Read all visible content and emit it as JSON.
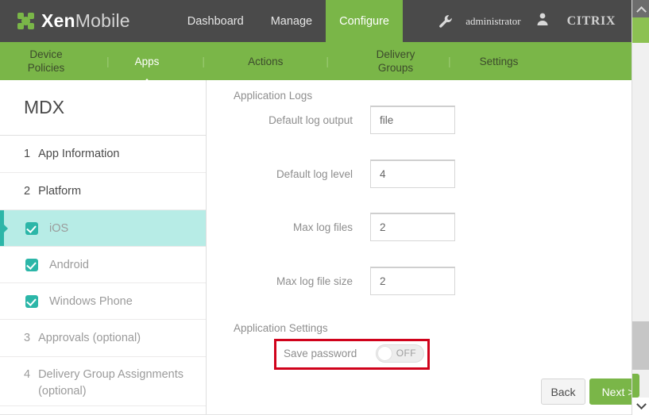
{
  "header": {
    "logo_brand": "Xen",
    "logo_brand2": "Mobile",
    "nav": [
      {
        "label": "Dashboard",
        "active": false
      },
      {
        "label": "Manage",
        "active": false
      },
      {
        "label": "Configure",
        "active": true
      }
    ],
    "wrench_icon": "wrench-icon",
    "username": "administrator",
    "user_icon": "user-icon",
    "vendor": "CITRIX"
  },
  "subnav": {
    "tabs": [
      {
        "label": "Device Policies",
        "active": false
      },
      {
        "label": "Apps",
        "active": true
      },
      {
        "label": "Actions",
        "active": false
      },
      {
        "label": "Delivery Groups",
        "active": false
      },
      {
        "label": "Settings",
        "active": false
      }
    ],
    "separator": "|"
  },
  "sidebar": {
    "title": "MDX",
    "items": [
      {
        "num": "1",
        "label": "App Information"
      },
      {
        "num": "2",
        "label": "Platform"
      }
    ],
    "platforms": [
      {
        "label": "iOS",
        "checked": true,
        "selected": true
      },
      {
        "label": "Android",
        "checked": true,
        "selected": false
      },
      {
        "label": "Windows Phone",
        "checked": true,
        "selected": false
      }
    ],
    "items_after": [
      {
        "num": "3",
        "label": "Approvals (optional)"
      },
      {
        "num": "4",
        "label": "Delivery Group Assignments (optional)"
      }
    ]
  },
  "main": {
    "section_logs": "Application Logs",
    "fields": [
      {
        "label": "Default log output",
        "value": "file"
      },
      {
        "label": "Default log level",
        "value": "4"
      },
      {
        "label": "Max log files",
        "value": "2"
      },
      {
        "label": "Max log file size",
        "value": "2"
      }
    ],
    "section_settings": "Application Settings",
    "toggle_label": "Save password",
    "toggle_state": "OFF",
    "highlight_color": "#d0021b"
  },
  "footer": {
    "back_label": "Back",
    "next_label": "Next >"
  },
  "scrollbar": {
    "up_icon": "chevron-up-icon",
    "down_icon": "chevron-down-icon"
  }
}
